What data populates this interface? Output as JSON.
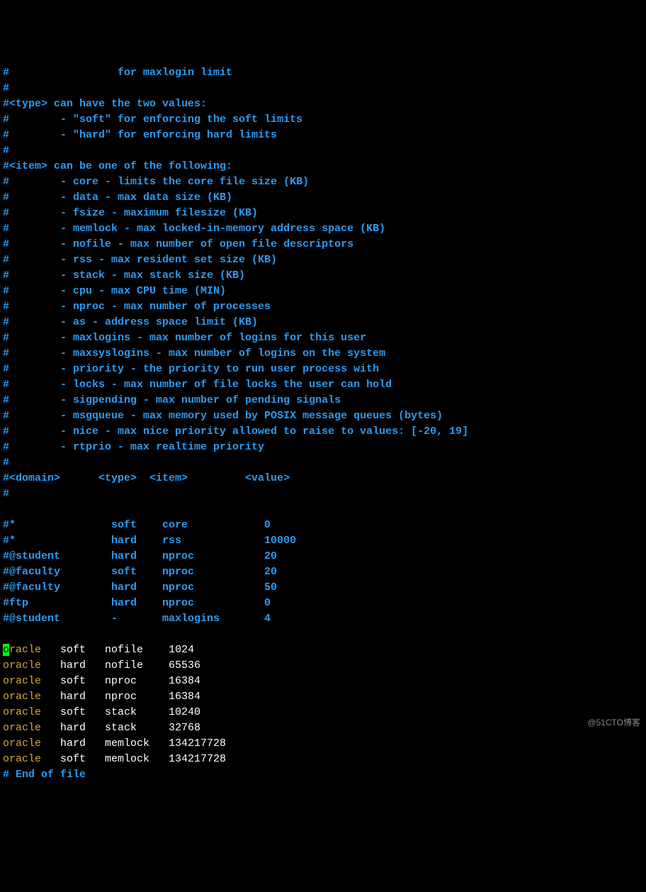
{
  "comments": [
    "#                 for maxlogin limit",
    "#",
    "#<type> can have the two values:",
    "#        - \"soft\" for enforcing the soft limits",
    "#        - \"hard\" for enforcing hard limits",
    "#",
    "#<item> can be one of the following:",
    "#        - core - limits the core file size (KB)",
    "#        - data - max data size (KB)",
    "#        - fsize - maximum filesize (KB)",
    "#        - memlock - max locked-in-memory address space (KB)",
    "#        - nofile - max number of open file descriptors",
    "#        - rss - max resident set size (KB)",
    "#        - stack - max stack size (KB)",
    "#        - cpu - max CPU time (MIN)",
    "#        - nproc - max number of processes",
    "#        - as - address space limit (KB)",
    "#        - maxlogins - max number of logins for this user",
    "#        - maxsyslogins - max number of logins on the system",
    "#        - priority - the priority to run user process with",
    "#        - locks - max number of file locks the user can hold",
    "#        - sigpending - max number of pending signals",
    "#        - msgqueue - max memory used by POSIX message queues (bytes)",
    "#        - nice - max nice priority allowed to raise to values: [-20, 19]",
    "#        - rtprio - max realtime priority",
    "#",
    "#<domain>      <type>  <item>         <value>",
    "#"
  ],
  "examples": [
    "#*               soft    core            0",
    "#*               hard    rss             10000",
    "#@student        hard    nproc           20",
    "#@faculty        soft    nproc           20",
    "#@faculty        hard    nproc           50",
    "#ftp             hard    nproc           0",
    "#@student        -       maxlogins       4"
  ],
  "blank": "",
  "entries": [
    {
      "domain": "oracle",
      "type": "soft",
      "item": "nofile",
      "value": "1024"
    },
    {
      "domain": "oracle",
      "type": "hard",
      "item": "nofile",
      "value": "65536"
    },
    {
      "domain": "oracle",
      "type": "soft",
      "item": "nproc",
      "value": "16384"
    },
    {
      "domain": "oracle",
      "type": "hard",
      "item": "nproc",
      "value": "16384"
    },
    {
      "domain": "oracle",
      "type": "soft",
      "item": "stack",
      "value": "10240"
    },
    {
      "domain": "oracle",
      "type": "hard",
      "item": "stack",
      "value": "32768"
    },
    {
      "domain": "oracle",
      "type": "hard",
      "item": "memlock",
      "value": "134217728"
    },
    {
      "domain": "oracle",
      "type": "soft",
      "item": "memlock",
      "value": "134217728"
    }
  ],
  "end_of_file": "# End of file",
  "watermark": "@51CTO博客"
}
